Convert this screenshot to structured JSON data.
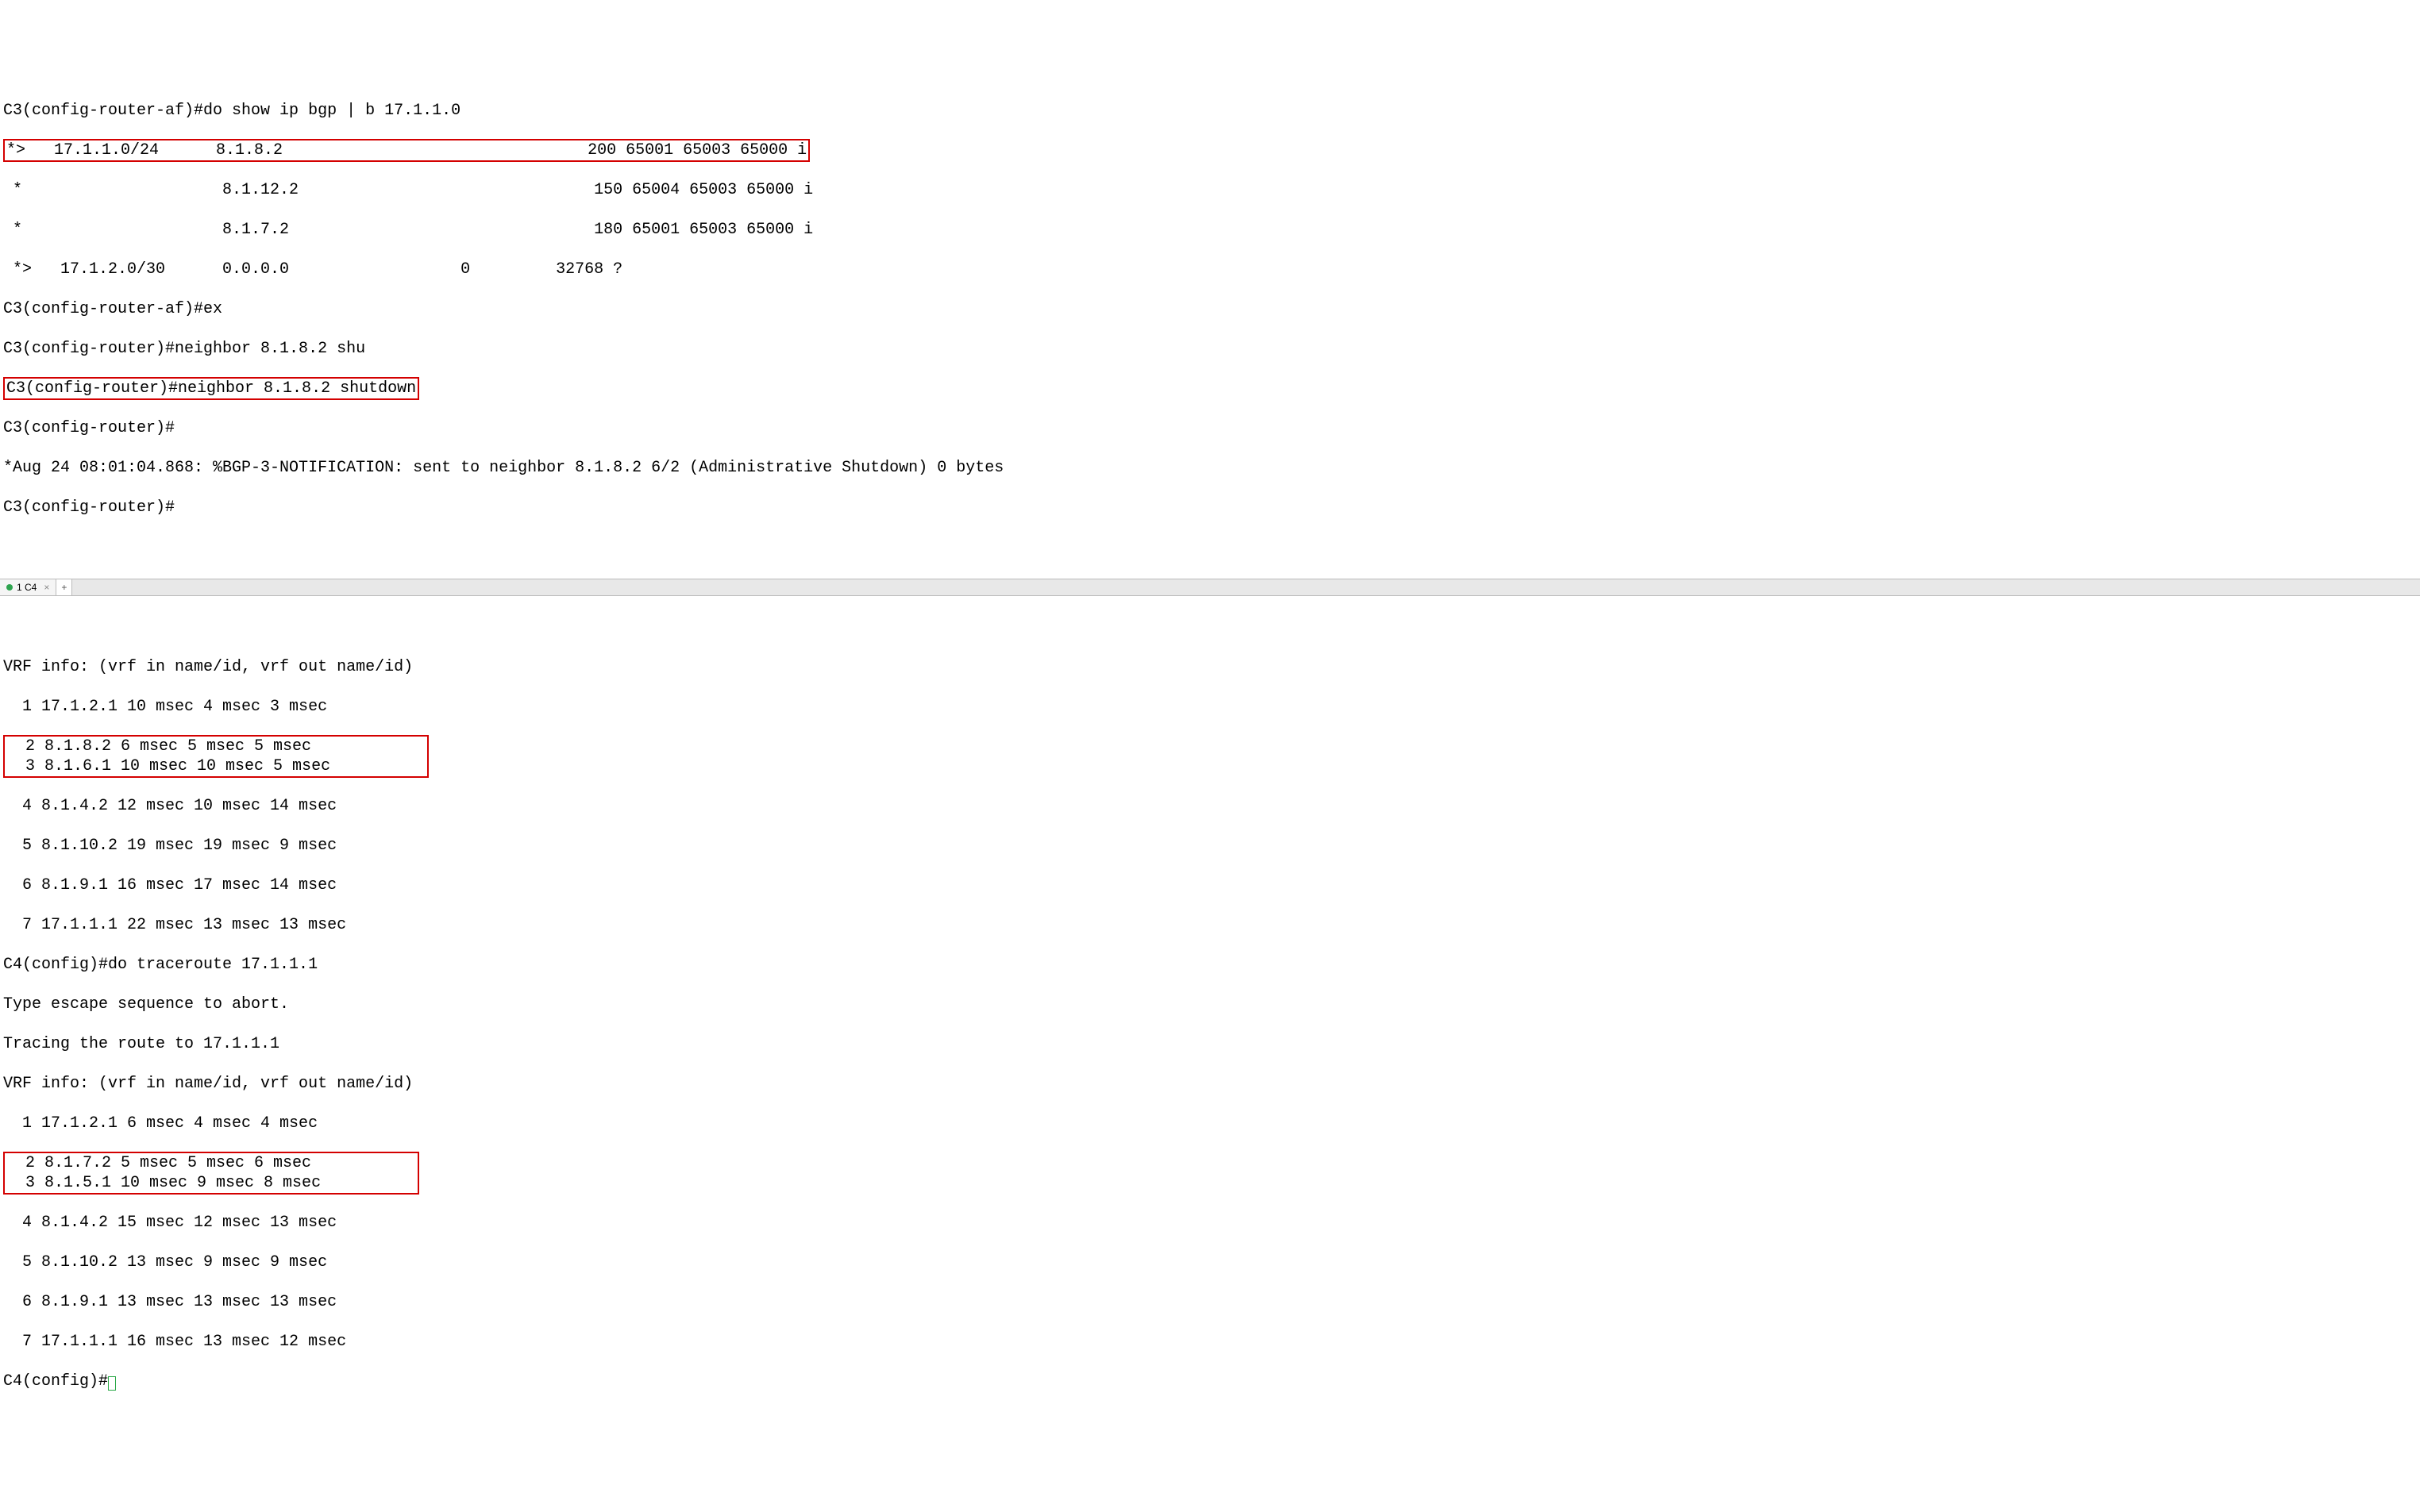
{
  "top": {
    "cmd1": "C3(config-router-af)#do show ip bgp | b 17.1.1.0",
    "bgp_row1": "*>   17.1.1.0/24      8.1.8.2                                200 65001 65003 65000 i",
    "bgp_row2": " *                     8.1.12.2                               150 65004 65003 65000 i",
    "bgp_row3": " *                     8.1.7.2                                180 65001 65003 65000 i",
    "bgp_row4": " *>   17.1.2.0/30      0.0.0.0                  0         32768 ?",
    "cmd2": "C3(config-router-af)#ex",
    "cmd3": "C3(config-router)#neighbor 8.1.8.2 shu",
    "cmd4_boxed": "C3(config-router)#neighbor 8.1.8.2 shutdown",
    "cmd5": "C3(config-router)#",
    "log1": "*Aug 24 08:01:04.868: %BGP-3-NOTIFICATION: sent to neighbor 8.1.8.2 6/2 (Administrative Shutdown) 0 bytes",
    "cmd6": "C3(config-router)#"
  },
  "tab": {
    "label": "1 C4"
  },
  "bottom": {
    "vrf1": "VRF info: (vrf in name/id, vrf out name/id)",
    "hop1": "  1 17.1.2.1 10 msec 4 msec 3 msec",
    "hop2": "  2 8.1.8.2 6 msec 5 msec 5 msec",
    "hop3": "  3 8.1.6.1 10 msec 10 msec 5 msec",
    "box1_pad": "          ",
    "hop4": "  4 8.1.4.2 12 msec 10 msec 14 msec",
    "hop5": "  5 8.1.10.2 19 msec 19 msec 9 msec",
    "hop6": "  6 8.1.9.1 16 msec 17 msec 14 msec",
    "hop7": "  7 17.1.1.1 22 msec 13 msec 13 msec",
    "cmd1": "C4(config)#do traceroute 17.1.1.1",
    "abort": "Type escape sequence to abort.",
    "tracing": "Tracing the route to 17.1.1.1",
    "vrf2": "VRF info: (vrf in name/id, vrf out name/id)",
    "t2_hop1": "  1 17.1.2.1 6 msec 4 msec 4 msec",
    "t2_hop2": "  2 8.1.7.2 5 msec 5 msec 6 msec",
    "t2_hop3": "  3 8.1.5.1 10 msec 9 msec 8 msec",
    "t2_hop4": "  4 8.1.4.2 15 msec 12 msec 13 msec",
    "t2_hop5": "  5 8.1.10.2 13 msec 9 msec 9 msec",
    "t2_hop6": "  6 8.1.9.1 13 msec 13 msec 13 msec",
    "t2_hop7": "  7 17.1.1.1 16 msec 13 msec 12 msec",
    "cmd2": "C4(config)#"
  }
}
